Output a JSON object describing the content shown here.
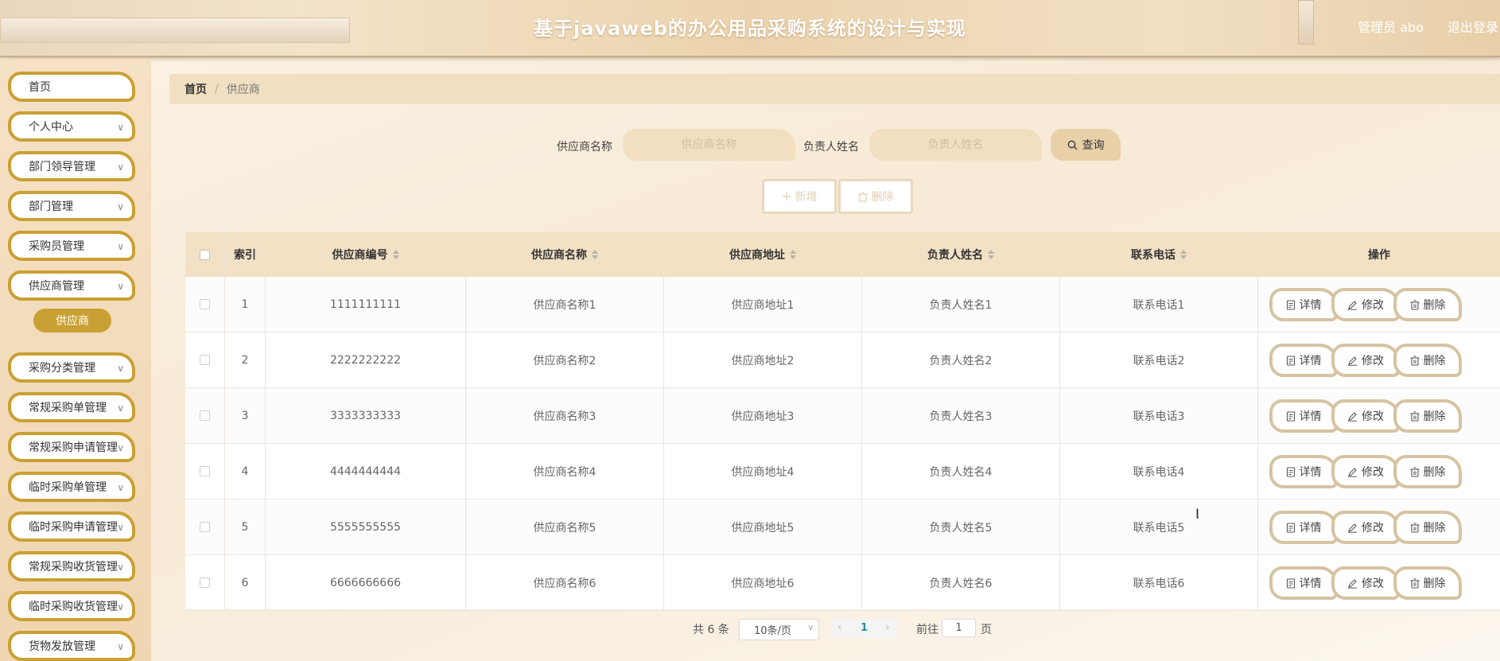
{
  "header": {
    "title": "基于javaweb的办公用品采购系统的设计与实现",
    "user": "管理员 abo",
    "logout": "退出登录"
  },
  "sidebar": {
    "items": [
      {
        "label": "首页",
        "chevron": false
      },
      {
        "label": "个人中心",
        "chevron": true
      },
      {
        "label": "部门领导管理",
        "chevron": true
      },
      {
        "label": "部门管理",
        "chevron": true
      },
      {
        "label": "采购员管理",
        "chevron": true
      },
      {
        "label": "供应商管理",
        "chevron": true
      },
      {
        "label": "采购分类管理",
        "chevron": true
      },
      {
        "label": "常规采购单管理",
        "chevron": true
      },
      {
        "label": "常规采购申请管理",
        "chevron": true
      },
      {
        "label": "临时采购单管理",
        "chevron": true
      },
      {
        "label": "临时采购申请管理",
        "chevron": true
      },
      {
        "label": "常规采购收货管理",
        "chevron": true
      },
      {
        "label": "临时采购收货管理",
        "chevron": true
      },
      {
        "label": "货物发放管理",
        "chevron": true
      }
    ],
    "sub_item": "供应商"
  },
  "breadcrumb": {
    "home": "首页",
    "separator": "/",
    "current": "供应商"
  },
  "search": {
    "name_label": "供应商名称",
    "name_placeholder": "供应商名称",
    "person_label": "负责人姓名",
    "person_placeholder": "负责人姓名",
    "query": "查询"
  },
  "toolbar": {
    "add": "新增",
    "delete": "删除"
  },
  "table": {
    "headers": [
      "索引",
      "供应商编号",
      "供应商名称",
      "供应商地址",
      "负责人姓名",
      "联系电话",
      "操作"
    ],
    "rows": [
      [
        "1",
        "1111111111",
        "供应商名称1",
        "供应商地址1",
        "负责人姓名1",
        "联系电话1"
      ],
      [
        "2",
        "2222222222",
        "供应商名称2",
        "供应商地址2",
        "负责人姓名2",
        "联系电话2"
      ],
      [
        "3",
        "3333333333",
        "供应商名称3",
        "供应商地址3",
        "负责人姓名3",
        "联系电话3"
      ],
      [
        "4",
        "4444444444",
        "供应商名称4",
        "供应商地址4",
        "负责人姓名4",
        "联系电话4"
      ],
      [
        "5",
        "5555555555",
        "供应商名称5",
        "供应商地址5",
        "负责人姓名5",
        "联系电话5"
      ],
      [
        "6",
        "6666666666",
        "供应商名称6",
        "供应商地址6",
        "负责人姓名6",
        "联系电话6"
      ]
    ],
    "actions": {
      "detail": "详情",
      "edit": "修改",
      "delete": "删除"
    }
  },
  "pagination": {
    "total": "共 6 条",
    "page_size": "10条/页",
    "current_page": "1",
    "goto_label": "前往",
    "goto_value": "1",
    "goto_unit": "页"
  },
  "colors": {
    "accent": "#c9a033",
    "header_bg": "#f2e1c5",
    "button_border": "#d6c3a2"
  }
}
